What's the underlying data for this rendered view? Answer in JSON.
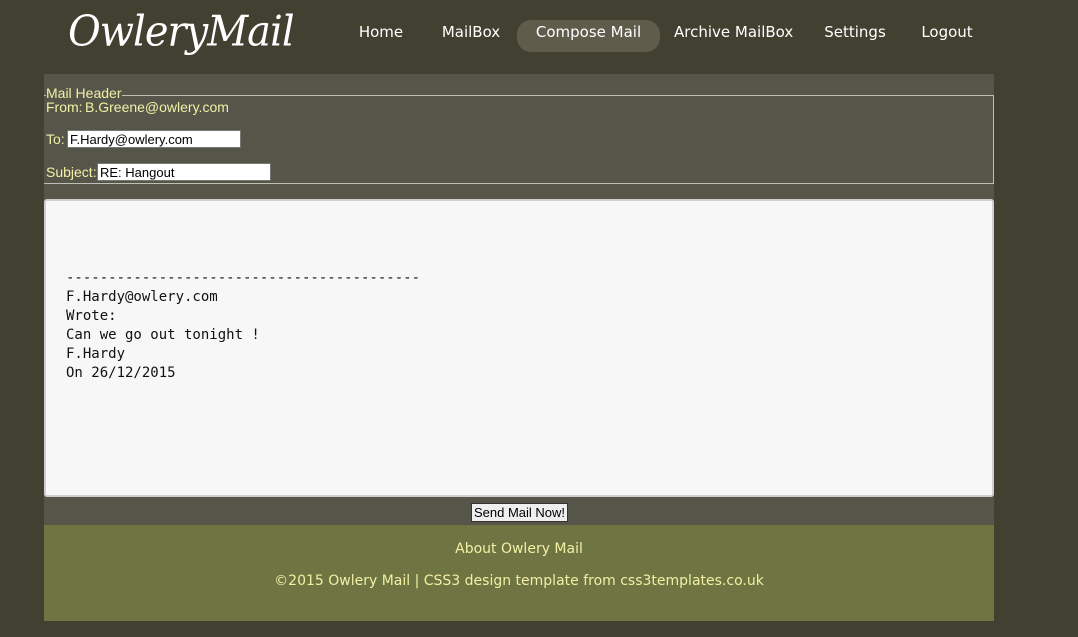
{
  "app": {
    "logo_text": "OwleryMail"
  },
  "nav": {
    "items": [
      {
        "label": "Home"
      },
      {
        "label": "MailBox"
      },
      {
        "label": "Compose Mail",
        "active": true
      },
      {
        "label": "Archive MailBox"
      },
      {
        "label": "Settings"
      },
      {
        "label": "Logout"
      }
    ]
  },
  "header": {
    "legend": "Mail Header",
    "from_label": "From:",
    "from_value": "B.Greene@owlery.com",
    "to_label": "To:",
    "to_value": "F.Hardy@owlery.com",
    "subject_label": "Subject:",
    "subject_value": "RE: Hangout"
  },
  "body": {
    "text": "\n------------------------------------------\nF.Hardy@owlery.com\nWrote:\nCan we go out tonight !\nF.Hardy\nOn 26/12/2015"
  },
  "actions": {
    "send_label": "Send Mail Now!"
  },
  "footer": {
    "about_label": "About Owlery Mail",
    "copyright": "©2015 Owlery Mail | CSS3 design template from css3templates.co.uk"
  },
  "colors": {
    "page_bg": "#414031",
    "panel_bg": "#56554a",
    "accent_text": "#f3f0a5",
    "footer_bg": "#6e7442",
    "active_nav_bg": "#5f5c4c"
  }
}
